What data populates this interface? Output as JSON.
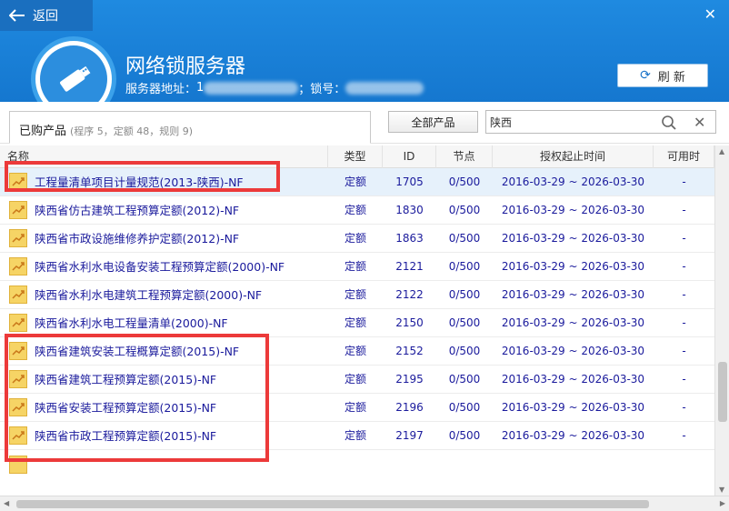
{
  "header": {
    "back_label": "返回",
    "title": "网络锁服务器",
    "server_addr_label": "服务器地址：",
    "server_addr_prefix": "1",
    "lock_label": "；锁号：",
    "refresh_label": "刷 新"
  },
  "toolbar": {
    "tab_label": "已购产品",
    "tab_summary": "(程序 5，定额 48，规则 9)",
    "all_products_label": "全部产品",
    "search_value": "陕西"
  },
  "table": {
    "columns": [
      "名称",
      "类型",
      "ID",
      "节点",
      "授权起止时间",
      "可用时"
    ],
    "rows": [
      {
        "name": "工程量清单项目计量规范(2013-陕西)-NF",
        "type": "定额",
        "id": "1705",
        "node": "0/500",
        "period": "2016-03-29 ~ 2026-03-30",
        "avail": "-"
      },
      {
        "name": "陕西省仿古建筑工程预算定额(2012)-NF",
        "type": "定额",
        "id": "1830",
        "node": "0/500",
        "period": "2016-03-29 ~ 2026-03-30",
        "avail": "-"
      },
      {
        "name": "陕西省市政设施维修养护定额(2012)-NF",
        "type": "定额",
        "id": "1863",
        "node": "0/500",
        "period": "2016-03-29 ~ 2026-03-30",
        "avail": "-"
      },
      {
        "name": "陕西省水利水电设备安装工程预算定额(2000)-NF",
        "type": "定额",
        "id": "2121",
        "node": "0/500",
        "period": "2016-03-29 ~ 2026-03-30",
        "avail": "-"
      },
      {
        "name": "陕西省水利水电建筑工程预算定额(2000)-NF",
        "type": "定额",
        "id": "2122",
        "node": "0/500",
        "period": "2016-03-29 ~ 2026-03-30",
        "avail": "-"
      },
      {
        "name": "陕西省水利水电工程量清单(2000)-NF",
        "type": "定额",
        "id": "2150",
        "node": "0/500",
        "period": "2016-03-29 ~ 2026-03-30",
        "avail": "-"
      },
      {
        "name": "陕西省建筑安装工程概算定额(2015)-NF",
        "type": "定额",
        "id": "2152",
        "node": "0/500",
        "period": "2016-03-29 ~ 2026-03-30",
        "avail": "-"
      },
      {
        "name": "陕西省建筑工程预算定额(2015)-NF",
        "type": "定额",
        "id": "2195",
        "node": "0/500",
        "period": "2016-03-29 ~ 2026-03-30",
        "avail": "-"
      },
      {
        "name": "陕西省安装工程预算定额(2015)-NF",
        "type": "定额",
        "id": "2196",
        "node": "0/500",
        "period": "2016-03-29 ~ 2026-03-30",
        "avail": "-"
      },
      {
        "name": "陕西省市政工程预算定额(2015)-NF",
        "type": "定额",
        "id": "2197",
        "node": "0/500",
        "period": "2016-03-29 ~ 2026-03-30",
        "avail": "-"
      }
    ]
  },
  "colors": {
    "header_blue": "#1f8ae0",
    "link_text": "#1a1a9c",
    "annotation_red": "#ec3a3a",
    "icon_yellow": "#f6d465"
  }
}
